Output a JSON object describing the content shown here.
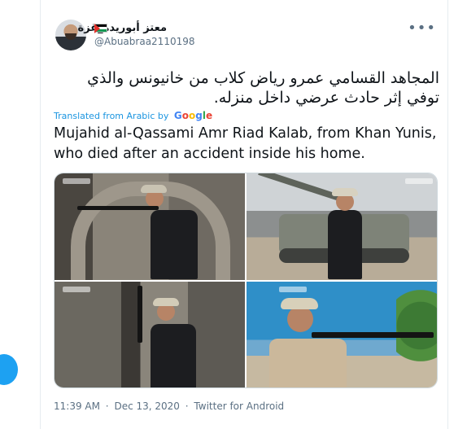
{
  "tweet": {
    "author": {
      "display_name": "معتز أبوريدة_غزة",
      "flag_icon": "palestine-flag-icon",
      "handle": "@Abuabraa2110198"
    },
    "more_icon": "more-horizontal-icon",
    "text_lines": [
      "المجاهد القسامي  عمرو رياض كلاب من خانيونس والذي",
      "توفي إثر حادث عرضي داخل منزله."
    ],
    "translated_from": "Translated from Arabic by",
    "translator": "Google",
    "translation_lines": [
      "Mujahid al-Qassami Amr Riad Kalab, from Khan Yunis,",
      "who died after an accident inside his home."
    ],
    "media": [
      {
        "name": "photo-tunnel-rifle"
      },
      {
        "name": "photo-tank"
      },
      {
        "name": "photo-doorway-rifle"
      },
      {
        "name": "photo-outdoor-rifle"
      }
    ],
    "time": "11:39 AM",
    "separator": "·",
    "date": "Dec 13, 2020",
    "source": "Twitter for Android"
  },
  "colors": {
    "accent": "#1da1f2",
    "link": "#1b95e0",
    "secondary_text": "#5b7083",
    "border": "#e6ecf0"
  }
}
